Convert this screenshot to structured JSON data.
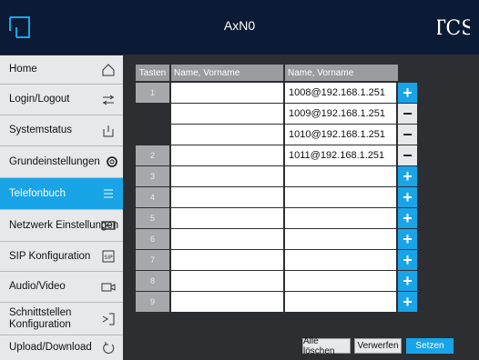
{
  "header": {
    "title": "AxN0",
    "brand": "TCS"
  },
  "sidebar": {
    "items": [
      {
        "label": "Home",
        "icon": "home-icon"
      },
      {
        "label": "Login/Logout",
        "icon": "login-icon"
      },
      {
        "label": "Systemstatus",
        "icon": "power-icon"
      },
      {
        "label": "Grundeinstellungen",
        "icon": "gear-icon"
      },
      {
        "label": "Telefonbuch",
        "icon": "list-icon",
        "active": true
      },
      {
        "label": "Netzwerk Einstellungen",
        "icon": "network-icon"
      },
      {
        "label": "SIP Konfiguration",
        "icon": "sip-icon"
      },
      {
        "label": "Audio/Video",
        "icon": "camera-icon"
      },
      {
        "label": "Schnittstellen Konfiguration",
        "icon": "interface-icon"
      },
      {
        "label": "Upload/Download",
        "icon": "refresh-icon"
      }
    ]
  },
  "table": {
    "headers": {
      "tasten": "Tasten",
      "name": "Name, Vorname",
      "number": "Name, Vorname"
    },
    "rows": [
      {
        "key": "1",
        "name": "",
        "number": "1008@192.168.1.251",
        "action": "+"
      },
      {
        "key": "",
        "name": "",
        "number": "1009@192.168.1.251",
        "action": "−"
      },
      {
        "key": "",
        "name": "",
        "number": "1010@192.168.1.251",
        "action": "−"
      },
      {
        "key": "2",
        "name": "",
        "number": "1011@192.168.1.251",
        "action": "−"
      },
      {
        "key": "3",
        "name": "",
        "number": "",
        "action": "+"
      },
      {
        "key": "4",
        "name": "",
        "number": "",
        "action": "+"
      },
      {
        "key": "5",
        "name": "",
        "number": "",
        "action": "+"
      },
      {
        "key": "6",
        "name": "",
        "number": "",
        "action": "+"
      },
      {
        "key": "7",
        "name": "",
        "number": "",
        "action": "+"
      },
      {
        "key": "8",
        "name": "",
        "number": "",
        "action": "+"
      },
      {
        "key": "9",
        "name": "",
        "number": "",
        "action": "+"
      }
    ]
  },
  "buttons": {
    "delete_all": "Alle löschen",
    "discard": "Verwerfen",
    "set": "Setzen"
  },
  "colors": {
    "accent": "#1aa4e8",
    "header_bg": "#0b1a35",
    "dark_bg": "#2c2e32"
  }
}
